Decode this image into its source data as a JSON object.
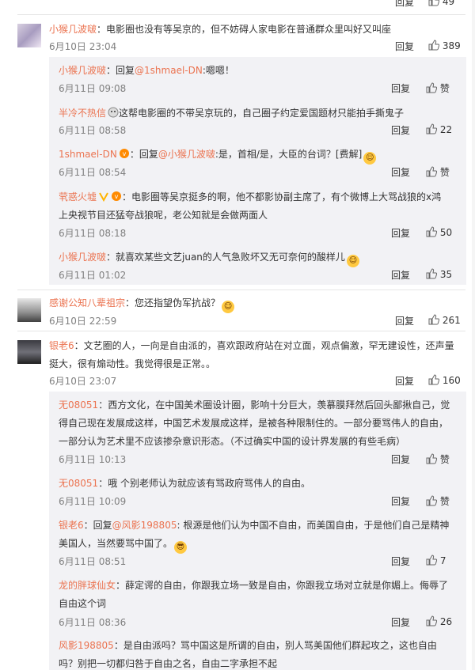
{
  "top_row": {
    "reply": "回复",
    "likes": "49"
  },
  "c1": {
    "name": "小猴几波啵",
    "text": "：电影圈也没有等吴京的，但不妨碍人家电影在普通群众里叫好又叫座",
    "time": "6月10日 23:04",
    "reply": "回复",
    "likes": "389",
    "subs": [
      {
        "name": "小猴几波啵",
        "text_pre": "：回复",
        "mention": "@1shmael-DN",
        "text": ":嗯嗯！",
        "time": "6月11日 09:08",
        "reply": "回复",
        "likes": "赞"
      },
      {
        "name": "半冷不热信",
        "text": "这帮电影圈的不带吴京玩的，自己圈子约定爱国题材只能拍手撕鬼子",
        "time": "6月11日 08:58",
        "reply": "回复",
        "likes": "22"
      },
      {
        "name": "1shmael-DN",
        "text_pre": "：回复",
        "mention": "@小猴几波啵",
        "text": ":是，首相/是，大臣的台词？[费解]",
        "time": "6月11日 08:54",
        "reply": "回复",
        "likes": "赞"
      },
      {
        "name": "茕惑火墟",
        "text": "：电影圈等吴京挺多的啊，他不都影协副主席了，有个微博上大骂战狼的x鸿",
        "text2": "上央视节目还猛夸战狼呢，老公知就是会做两面人",
        "time": "6月11日 08:18",
        "reply": "回复",
        "likes": "50"
      },
      {
        "name": "小猴几波啵",
        "text": "：就喜欢某些文艺juan的人气急败坏又无可奈何的酸样儿",
        "time": "6月11日 01:02",
        "reply": "回复",
        "likes": "35"
      }
    ]
  },
  "c2": {
    "name": "感谢公知八辈祖宗",
    "text": "：您还指望伪军抗战？",
    "time": "6月10日 22:59",
    "reply": "回复",
    "likes": "261"
  },
  "c3": {
    "name": "银老6",
    "text": "：文艺圈的人，一向是自由派的，喜欢跟政府站在对立面，观点偏激，罕无建设性，还声量",
    "text2": "挺大，很有煽动性。我觉得很是正常。。",
    "time": "6月10日 23:07",
    "reply": "回复",
    "likes": "160",
    "subs": [
      {
        "name": "无08051",
        "text": "：西方文化，在中国美术圈设计圈，影响十分巨大，羡慕膜拜然后回头鄙揪自己，觉",
        "text2": "得自己现在发展成这样，中国艺术发展成这样，是被各种限制住的。一部分要骂伟人的自由，",
        "text3": "一部分认为艺术里不应该掺杂意识形态。（不过确实中国的设计界发展的有些毛病）",
        "time": "6月11日 10:13",
        "reply": "回复",
        "likes": "赞"
      },
      {
        "name": "无08051",
        "text": "：哦 个别老师认为就应该有骂政府骂伟人的自由。",
        "time": "6月11日 10:09",
        "reply": "回复",
        "likes": "赞"
      },
      {
        "name": "银老6",
        "text_pre": "：回复",
        "mention": "@风影198805",
        "text": ": 根源是他们认为中国不自由，而美国自由，于是他们自己是精神",
        "text2": "美国人，当然要骂中国了。",
        "time": "6月11日 08:51",
        "reply": "回复",
        "likes": "7"
      },
      {
        "name": "龙的胖球仙女",
        "text": "：薛定谔的自由，你跟我立场一致是自由，你跟我立场对立就是你媚上。侮辱了",
        "text2": "自由这个词",
        "time": "6月11日 08:36",
        "reply": "回复",
        "likes": "26"
      },
      {
        "name": "风影198805",
        "text": "：是自由派吗？骂中国这是所谓的自由，别人骂美国他们群起攻之，这也自由",
        "text2": "吗？别把一切都归咎于自由之名，自由二字承担不起"
      }
    ]
  },
  "colors": {
    "name": "#eb7350",
    "text": "#333333",
    "meta": "#808080",
    "subbg": "#f2f2f5"
  }
}
